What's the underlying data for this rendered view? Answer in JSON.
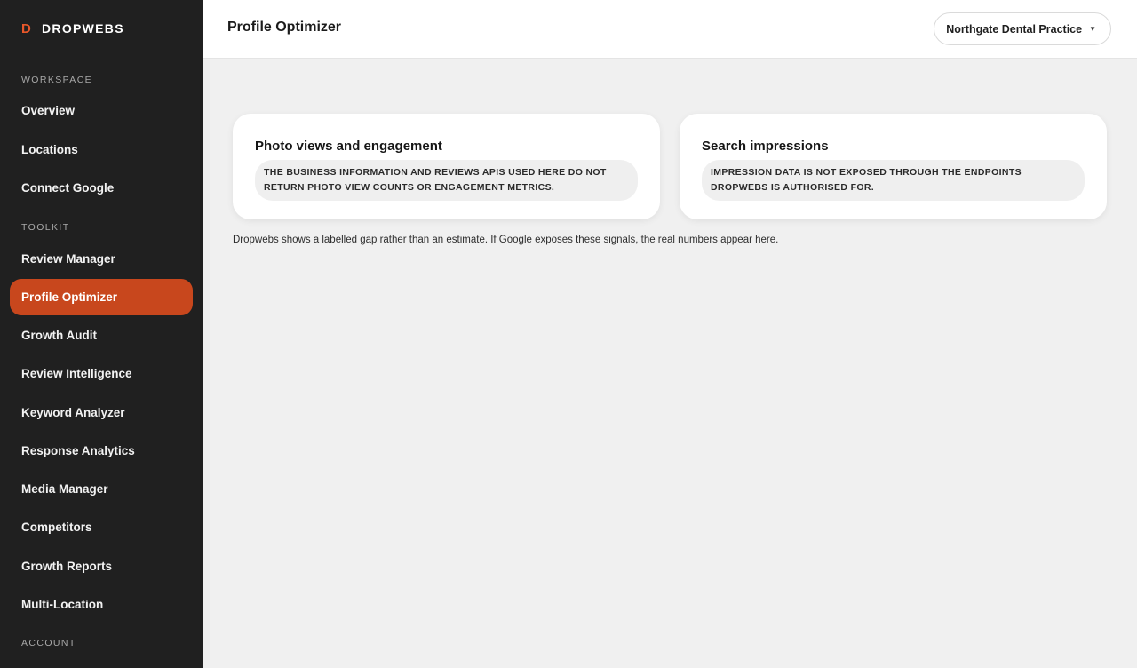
{
  "brand": {
    "mark": "D",
    "name": "DROPWEBS"
  },
  "sidebar": {
    "sections": [
      {
        "label": "WORKSPACE"
      },
      {
        "label": "TOOLKIT"
      },
      {
        "label": "ACCOUNT"
      }
    ],
    "workspace_items": [
      {
        "label": "Overview"
      },
      {
        "label": "Locations"
      },
      {
        "label": "Connect Google"
      }
    ],
    "toolkit_items": [
      {
        "label": "Review Manager"
      },
      {
        "label": "Profile Optimizer",
        "active": true
      },
      {
        "label": "Growth Audit"
      },
      {
        "label": "Review Intelligence"
      },
      {
        "label": "Keyword Analyzer"
      },
      {
        "label": "Response Analytics"
      },
      {
        "label": "Media Manager"
      },
      {
        "label": "Competitors"
      },
      {
        "label": "Growth Reports"
      },
      {
        "label": "Multi-Location"
      }
    ]
  },
  "header": {
    "title": "Profile Optimizer",
    "location_select": {
      "selected": "Northgate Dental Practice",
      "icon": "chevron-down-icon"
    }
  },
  "cards": [
    {
      "title": "Photo views and engagement",
      "note": "THE BUSINESS INFORMATION AND REVIEWS APIS USED HERE DO NOT RETURN PHOTO VIEW COUNTS OR ENGAGEMENT METRICS."
    },
    {
      "title": "Search impressions",
      "note": "IMPRESSION DATA IS NOT EXPOSED THROUGH THE ENDPOINTS DROPWEBS IS AUTHORISED FOR."
    }
  ],
  "footnote": "Dropwebs shows a labelled gap rather than an estimate. If Google exposes these signals, the real numbers appear here.",
  "colors": {
    "sidebar_bg": "#202020",
    "accent": "#c8471d",
    "brand_mark": "#e8572a",
    "page_bg": "#f0f0f0"
  }
}
